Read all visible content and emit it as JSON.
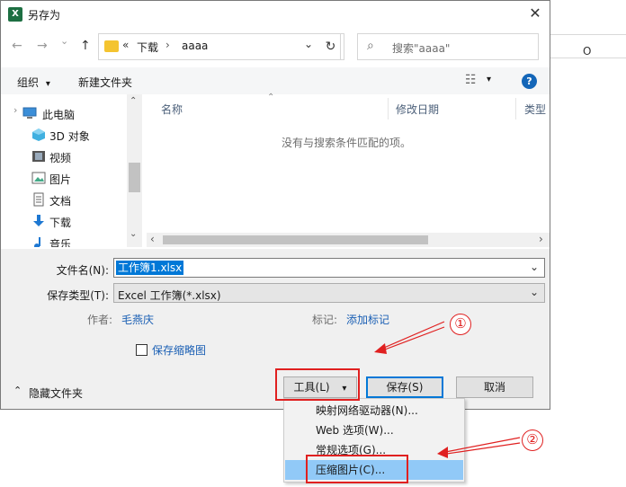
{
  "background": {
    "cell_text": "O"
  },
  "dialog": {
    "title": "另存为",
    "app_icon_text": "X",
    "close_glyph": "✕"
  },
  "nav": {
    "back_glyph": "←",
    "forward_glyph": "→",
    "history_glyph": "⌄",
    "up_glyph": "↑",
    "address_prefix": "«",
    "address_parts": [
      "下载",
      "aaaa"
    ],
    "address_sep": "›",
    "address_dropdown": "⌄",
    "refresh_glyph": "↻",
    "search_icon": "⌕",
    "search_placeholder": "搜索\"aaaa\""
  },
  "toolbar": {
    "organize_label": "组织",
    "organize_caret": "▾",
    "new_folder_label": "新建文件夹",
    "view_glyph": "☷",
    "view_caret": "▾",
    "help_glyph": "?"
  },
  "navpane": {
    "items": [
      {
        "label": "此电脑",
        "icon": "computer-icon"
      },
      {
        "label": "3D 对象",
        "icon": "cube-icon"
      },
      {
        "label": "视频",
        "icon": "video-icon"
      },
      {
        "label": "图片",
        "icon": "picture-icon"
      },
      {
        "label": "文档",
        "icon": "document-icon"
      },
      {
        "label": "下载",
        "icon": "download-icon"
      },
      {
        "label": "音乐",
        "icon": "music-icon"
      }
    ],
    "scroll_up": "⌃",
    "scroll_down": "⌄",
    "expand_caret": "›"
  },
  "filelist": {
    "columns": [
      "名称",
      "修改日期",
      "类型"
    ],
    "sort_caret": "⌃",
    "empty_message": "没有与搜索条件匹配的项。",
    "hscroll_left": "‹",
    "hscroll_right": "›"
  },
  "form": {
    "filename_label": "文件名(N):",
    "filename_value": "工作簿1.xlsx",
    "filetype_label": "保存类型(T):",
    "filetype_value": "Excel 工作簿(*.xlsx)",
    "dropdown_caret": "⌄",
    "author_label": "作者:",
    "author_value": "毛燕庆",
    "tags_label": "标记:",
    "tags_value": "添加标记",
    "thumbnail_label": "保存缩略图",
    "thumbnail_checked": false
  },
  "footer": {
    "hide_folders_caret": "⌃",
    "hide_folders_label": "隐藏文件夹",
    "tools_label": "工具(L)",
    "tools_caret": "▾",
    "save_label": "保存(S)",
    "cancel_label": "取消"
  },
  "tools_menu": {
    "items": [
      "映射网络驱动器(N)...",
      "Web 选项(W)...",
      "常规选项(G)...",
      "压缩图片(C)..."
    ],
    "highlighted_index": 3
  },
  "annotations": {
    "step1": "①",
    "step2": "②",
    "color": "#e02020"
  }
}
